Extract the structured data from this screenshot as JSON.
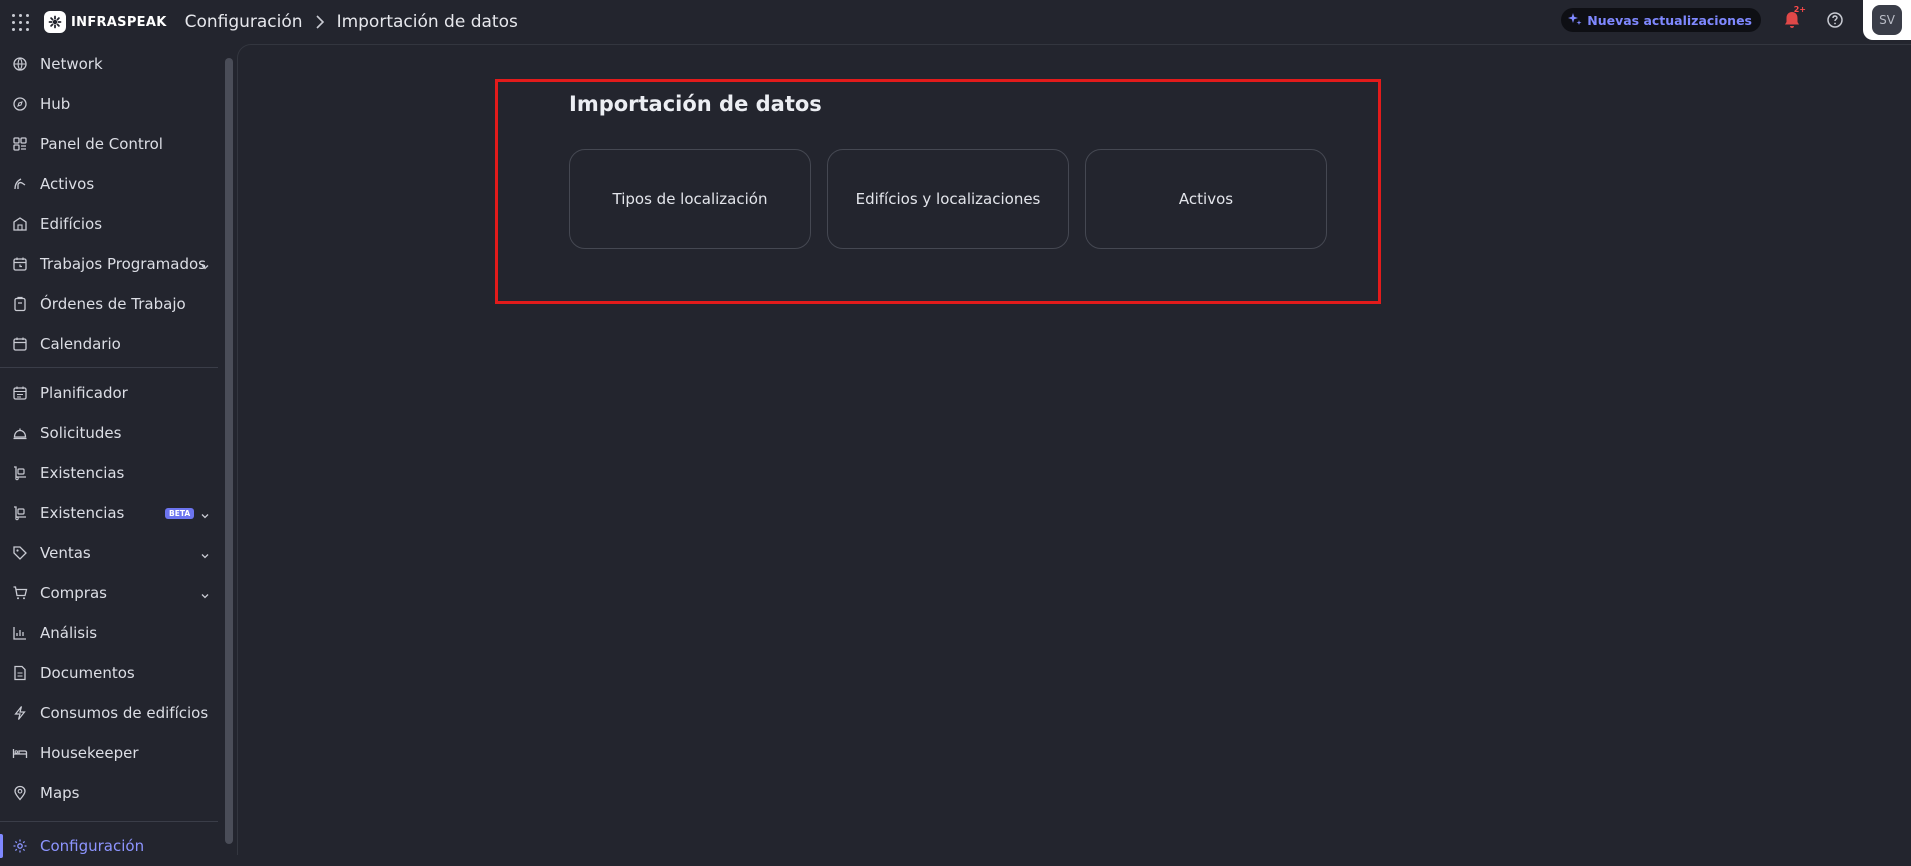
{
  "header": {
    "logo_text": "INFRASPEAK",
    "breadcrumb": [
      "Configuración",
      "Importación de datos"
    ],
    "updates_label": "Nuevas actualizaciones",
    "notification_badge": "2+",
    "avatar_initials": "SV",
    "accent_color": "#7f88ff"
  },
  "sidebar": {
    "items": [
      {
        "label": "Network",
        "icon": "globe-icon"
      },
      {
        "label": "Hub",
        "icon": "compass-icon"
      },
      {
        "label": "Panel de Control",
        "icon": "dashboard-icon"
      },
      {
        "label": "Activos",
        "icon": "asset-icon"
      },
      {
        "label": "Edifícios",
        "icon": "building-icon"
      },
      {
        "label": "Trabajos Programados",
        "icon": "calendar-clock-icon",
        "expandable": true
      },
      {
        "label": "Órdenes de Trabajo",
        "icon": "clipboard-icon"
      },
      {
        "label": "Calendario",
        "icon": "calendar-icon"
      },
      {
        "label": "Planificador",
        "icon": "planner-icon"
      },
      {
        "label": "Solicitudes",
        "icon": "bell-service-icon"
      },
      {
        "label": "Existencias",
        "icon": "cart-dolly-icon"
      },
      {
        "label": "Existencias",
        "icon": "cart-dolly-icon",
        "badge": "BETA",
        "expandable": true
      },
      {
        "label": "Ventas",
        "icon": "tag-icon",
        "expandable": true
      },
      {
        "label": "Compras",
        "icon": "shopping-cart-icon",
        "expandable": true
      },
      {
        "label": "Análisis",
        "icon": "bar-chart-icon"
      },
      {
        "label": "Documentos",
        "icon": "document-icon"
      },
      {
        "label": "Consumos de edifícios",
        "icon": "lightning-icon"
      },
      {
        "label": "Housekeeper",
        "icon": "bed-icon"
      },
      {
        "label": "Maps",
        "icon": "map-pin-icon"
      },
      {
        "label": "Configuración",
        "icon": "gear-icon",
        "active": true
      }
    ]
  },
  "main": {
    "title": "Importación de datos",
    "cards": [
      "Tipos de localización",
      "Edifícios y localizaciones",
      "Activos"
    ]
  }
}
